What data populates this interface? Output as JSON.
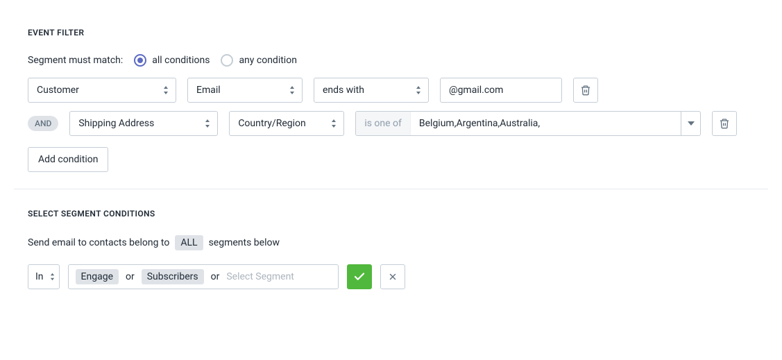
{
  "eventFilter": {
    "title": "EVENT FILTER",
    "matchLabel": "Segment must match:",
    "radios": {
      "all": "all conditions",
      "any": "any condition",
      "selected": "all"
    },
    "row1": {
      "entity": "Customer",
      "attribute": "Email",
      "operator": "ends with",
      "value": "@gmail.com"
    },
    "row2": {
      "logic": "AND",
      "entity": "Shipping Address",
      "attribute": "Country/Region",
      "operatorLabel": "is one of",
      "values": "Belgium,Argentina,Australia,"
    },
    "addCondition": "Add condition"
  },
  "segmentConditions": {
    "title": "SELECT SEGMENT CONDITIONS",
    "sentence": {
      "pre": "Send email to contacts belong to",
      "badge": "ALL",
      "post": "segments below"
    },
    "inSelect": "In",
    "chips": [
      "Engage",
      "Subscribers"
    ],
    "or": "or",
    "placeholder": "Select Segment"
  }
}
